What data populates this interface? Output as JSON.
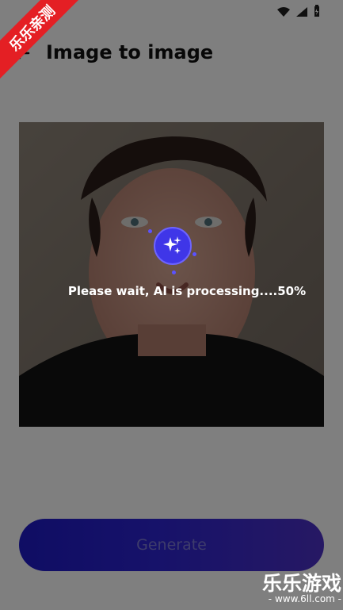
{
  "header": {
    "title": "Image to image",
    "back_icon": "arrow-left-icon"
  },
  "main": {
    "photo_alt": "Young man portrait",
    "processing_text": "Please wait, AI is processing....50%",
    "progress_percent": 50
  },
  "actions": {
    "generate_label": "Generate"
  },
  "status_bar": {
    "icons": [
      "wifi-icon",
      "signal-icon",
      "battery-icon"
    ]
  },
  "watermark": {
    "ribbon_text": "乐乐亲测",
    "brand_text": "乐乐游戏",
    "brand_url": "- www.6ll.com -"
  },
  "colors": {
    "accent": "#3f36e8",
    "button": "#2d24d4",
    "overlay": "rgba(0,0,0,0.5)"
  }
}
